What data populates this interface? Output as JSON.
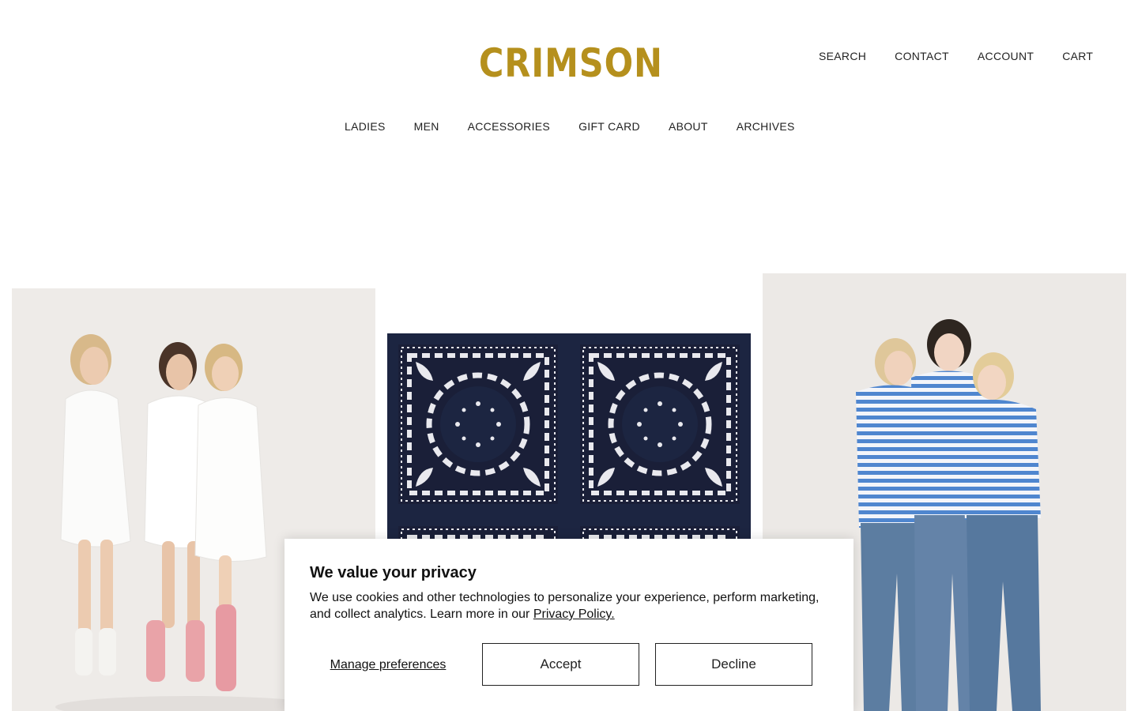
{
  "brand": {
    "logo_text": "CRIMSON",
    "logo_color": "#b5901d"
  },
  "utility_nav": [
    {
      "label": "SEARCH"
    },
    {
      "label": "CONTACT"
    },
    {
      "label": "ACCOUNT"
    },
    {
      "label": "CART"
    }
  ],
  "main_nav": [
    {
      "label": "LADIES"
    },
    {
      "label": "MEN"
    },
    {
      "label": "ACCESSORIES"
    },
    {
      "label": "GIFT CARD"
    },
    {
      "label": "ABOUT"
    },
    {
      "label": "ARCHIVES"
    }
  ],
  "product_tiles": [
    {
      "subject": "three women in white shirts with socks",
      "background": "#eeebe8"
    },
    {
      "subject": "navy paisley bandana print",
      "background": "#1c2541"
    },
    {
      "subject": "three women in blue striped tops and jeans",
      "background": "#ece9e6"
    }
  ],
  "cookie_banner": {
    "title": "We value your privacy",
    "body": "We use cookies and other technologies to personalize your experience, perform marketing, and collect analytics. Learn more in our ",
    "policy_link": "Privacy Policy.",
    "manage_label": "Manage preferences",
    "accept_label": "Accept",
    "decline_label": "Decline"
  }
}
